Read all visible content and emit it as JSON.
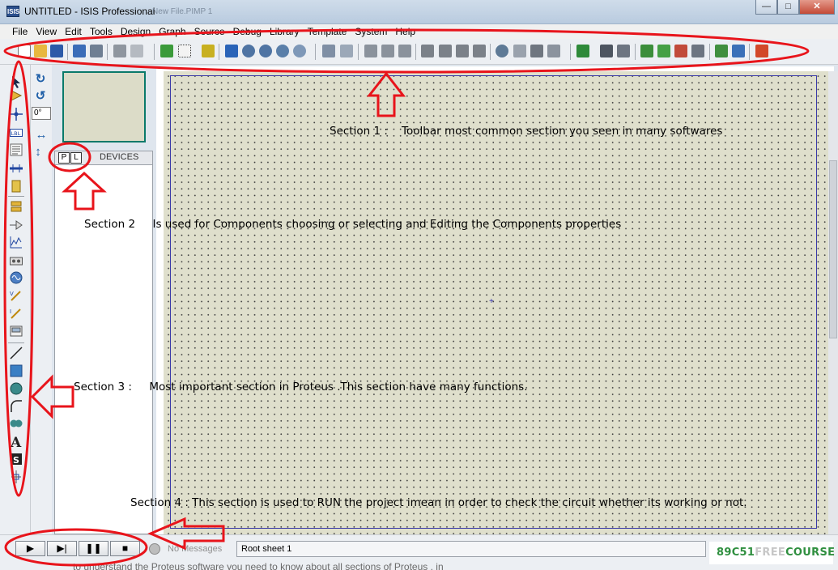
{
  "window": {
    "app_icon_text": "ISIS",
    "title": "UNTITLED - ISIS Professional",
    "ghost_title": "New File.PIMP 1",
    "controls": {
      "minimize": "—",
      "maximize": "□",
      "close": "✕"
    }
  },
  "menu": [
    "File",
    "View",
    "Edit",
    "Tools",
    "Design",
    "Graph",
    "Source",
    "Debug",
    "Library",
    "Template",
    "System",
    "Help"
  ],
  "toolbar": {
    "icons": [
      "new-file-icon",
      "open-folder-icon",
      "save-icon",
      "import-section-icon",
      "export-section-icon",
      "print-icon",
      "print-area-icon",
      "refresh-icon",
      "grid-toggle-icon",
      "origin-icon",
      "pan-icon",
      "zoom-in-icon",
      "zoom-out-icon",
      "zoom-all-icon",
      "zoom-area-icon",
      "undo-icon",
      "redo-icon",
      "cut-icon",
      "copy-icon",
      "paste-icon",
      "block-copy-icon",
      "block-move-icon",
      "block-rotate-icon",
      "block-delete-icon",
      "pick-device-icon",
      "make-device-icon",
      "package-tool-icon",
      "decompose-icon",
      "wire-autorouter-icon",
      "search-tag-icon",
      "property-assign-icon",
      "new-sheet-icon",
      "add-sheet-icon",
      "remove-sheet-icon",
      "goto-sheet-icon",
      "bill-of-materials-icon",
      "electrical-check-icon",
      "netlist-to-ares-icon"
    ]
  },
  "tools": {
    "left": [
      "selection-mode-icon",
      "component-mode-icon",
      "junction-dot-icon",
      "wire-label-icon",
      "text-script-icon",
      "buses-icon",
      "subcircuit-icon",
      "terminals-icon",
      "device-pins-icon",
      "graph-mode-icon",
      "tape-recorder-icon",
      "generator-icon",
      "voltage-probe-icon",
      "current-probe-icon",
      "virtual-instruments-icon",
      "line-icon",
      "box-icon",
      "circle-icon",
      "arc-icon",
      "path-icon",
      "text-icon",
      "symbol-icon",
      "marker-icon"
    ],
    "rotate_cw": "↻",
    "rotate_ccw": "↺",
    "angle": "0°",
    "mirror_x": "↔",
    "mirror_y": "↕"
  },
  "device_panel": {
    "pick_button": "P",
    "library_button": "L",
    "header": "DEVICES"
  },
  "canvas": {
    "origin_marker": "+"
  },
  "annotations": {
    "section1": "Section 1 :    Toolbar most common section you seen in many softwares",
    "section2": "Section 2     Is used for Components choosing or selecting and Editing the Components properties",
    "section3": "Section 3 :     Most important section in Proteus .This section have many functions.",
    "section4": "Section 4 : This section is used to RUN the project imean in order to check the circuit whether its working or not."
  },
  "status": {
    "play": "▶",
    "step": "▶|",
    "pause": "❚❚",
    "stop": "■",
    "messages": "No Messages",
    "sheet": "Root sheet 1",
    "bottom_text": "to understand the Proteus software you need to know about all sections of Proteus , in"
  },
  "brand": {
    "part1": "89C51",
    "part2": "FREE",
    "part3": "COURSE"
  },
  "colors": {
    "highlight_red": "#e8141b",
    "canvas_bg": "#dfdfcc",
    "sheet_border": "#3a3aa8",
    "brand_green": "#2f8f3f"
  }
}
